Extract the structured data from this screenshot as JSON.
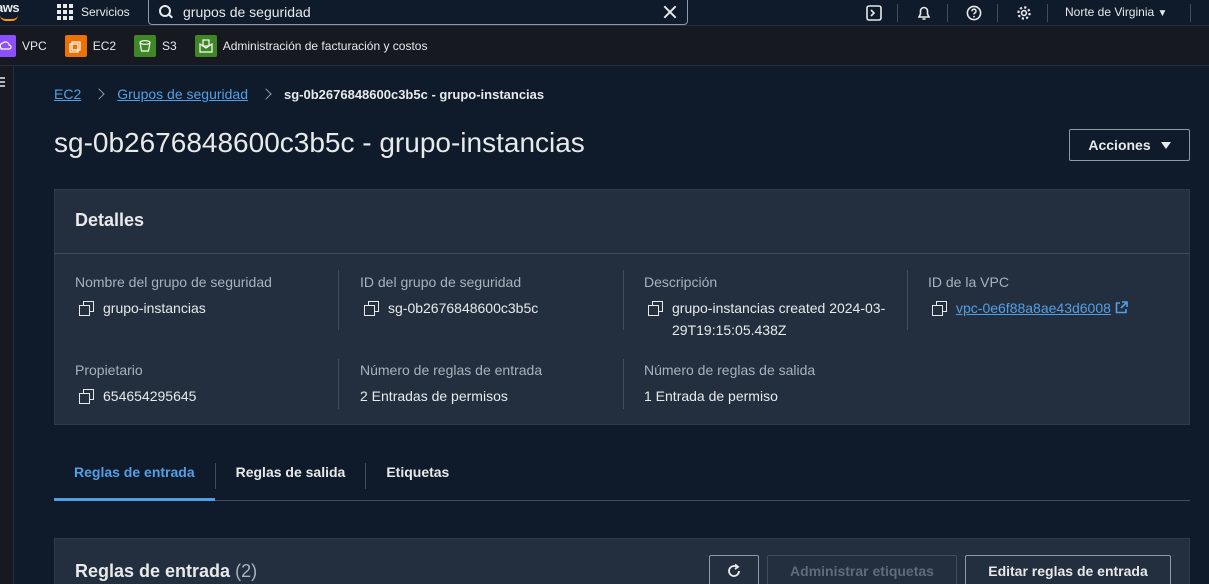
{
  "nav": {
    "logo": "aws",
    "services_label": "Servicios",
    "search_value": "grupos de seguridad",
    "region": "Norte de Virginia"
  },
  "favorites": [
    {
      "label": "VPC",
      "color": "#8c4fff"
    },
    {
      "label": "EC2",
      "color": "#ed7100"
    },
    {
      "label": "S3",
      "color": "#3f8624"
    },
    {
      "label": "Administración de facturación y costos",
      "color": "#3f8624"
    }
  ],
  "breadcrumb": {
    "item1": "EC2",
    "item2": "Grupos de seguridad",
    "current": "sg-0b2676848600c3b5c - grupo-instancias"
  },
  "page": {
    "title": "sg-0b2676848600c3b5c - grupo-instancias",
    "actions_label": "Acciones"
  },
  "details": {
    "heading": "Detalles",
    "name_label": "Nombre del grupo de seguridad",
    "name_value": "grupo-instancias",
    "id_label": "ID del grupo de seguridad",
    "id_value": "sg-0b2676848600c3b5c",
    "desc_label": "Descripción",
    "desc_value": "grupo-instancias created 2024-03-29T19:15:05.438Z",
    "vpc_label": "ID de la VPC",
    "vpc_value": "vpc-0e6f88a8ae43d6008",
    "owner_label": "Propietario",
    "owner_value": "654654295645",
    "inbound_label": "Número de reglas de entrada",
    "inbound_value": "2 Entradas de permisos",
    "outbound_label": "Número de reglas de salida",
    "outbound_value": "1 Entrada de permiso"
  },
  "tabs": [
    {
      "label": "Reglas de entrada",
      "active": true
    },
    {
      "label": "Reglas de salida",
      "active": false
    },
    {
      "label": "Etiquetas",
      "active": false
    }
  ],
  "inbound_rules": {
    "title": "Reglas de entrada",
    "count": "(2)",
    "manage_tags_label": "Administrar etiquetas",
    "edit_label": "Editar reglas de entrada"
  },
  "colors": {
    "accent": "#539fe5",
    "background": "#0f1b2a",
    "panel": "#232f3e"
  }
}
